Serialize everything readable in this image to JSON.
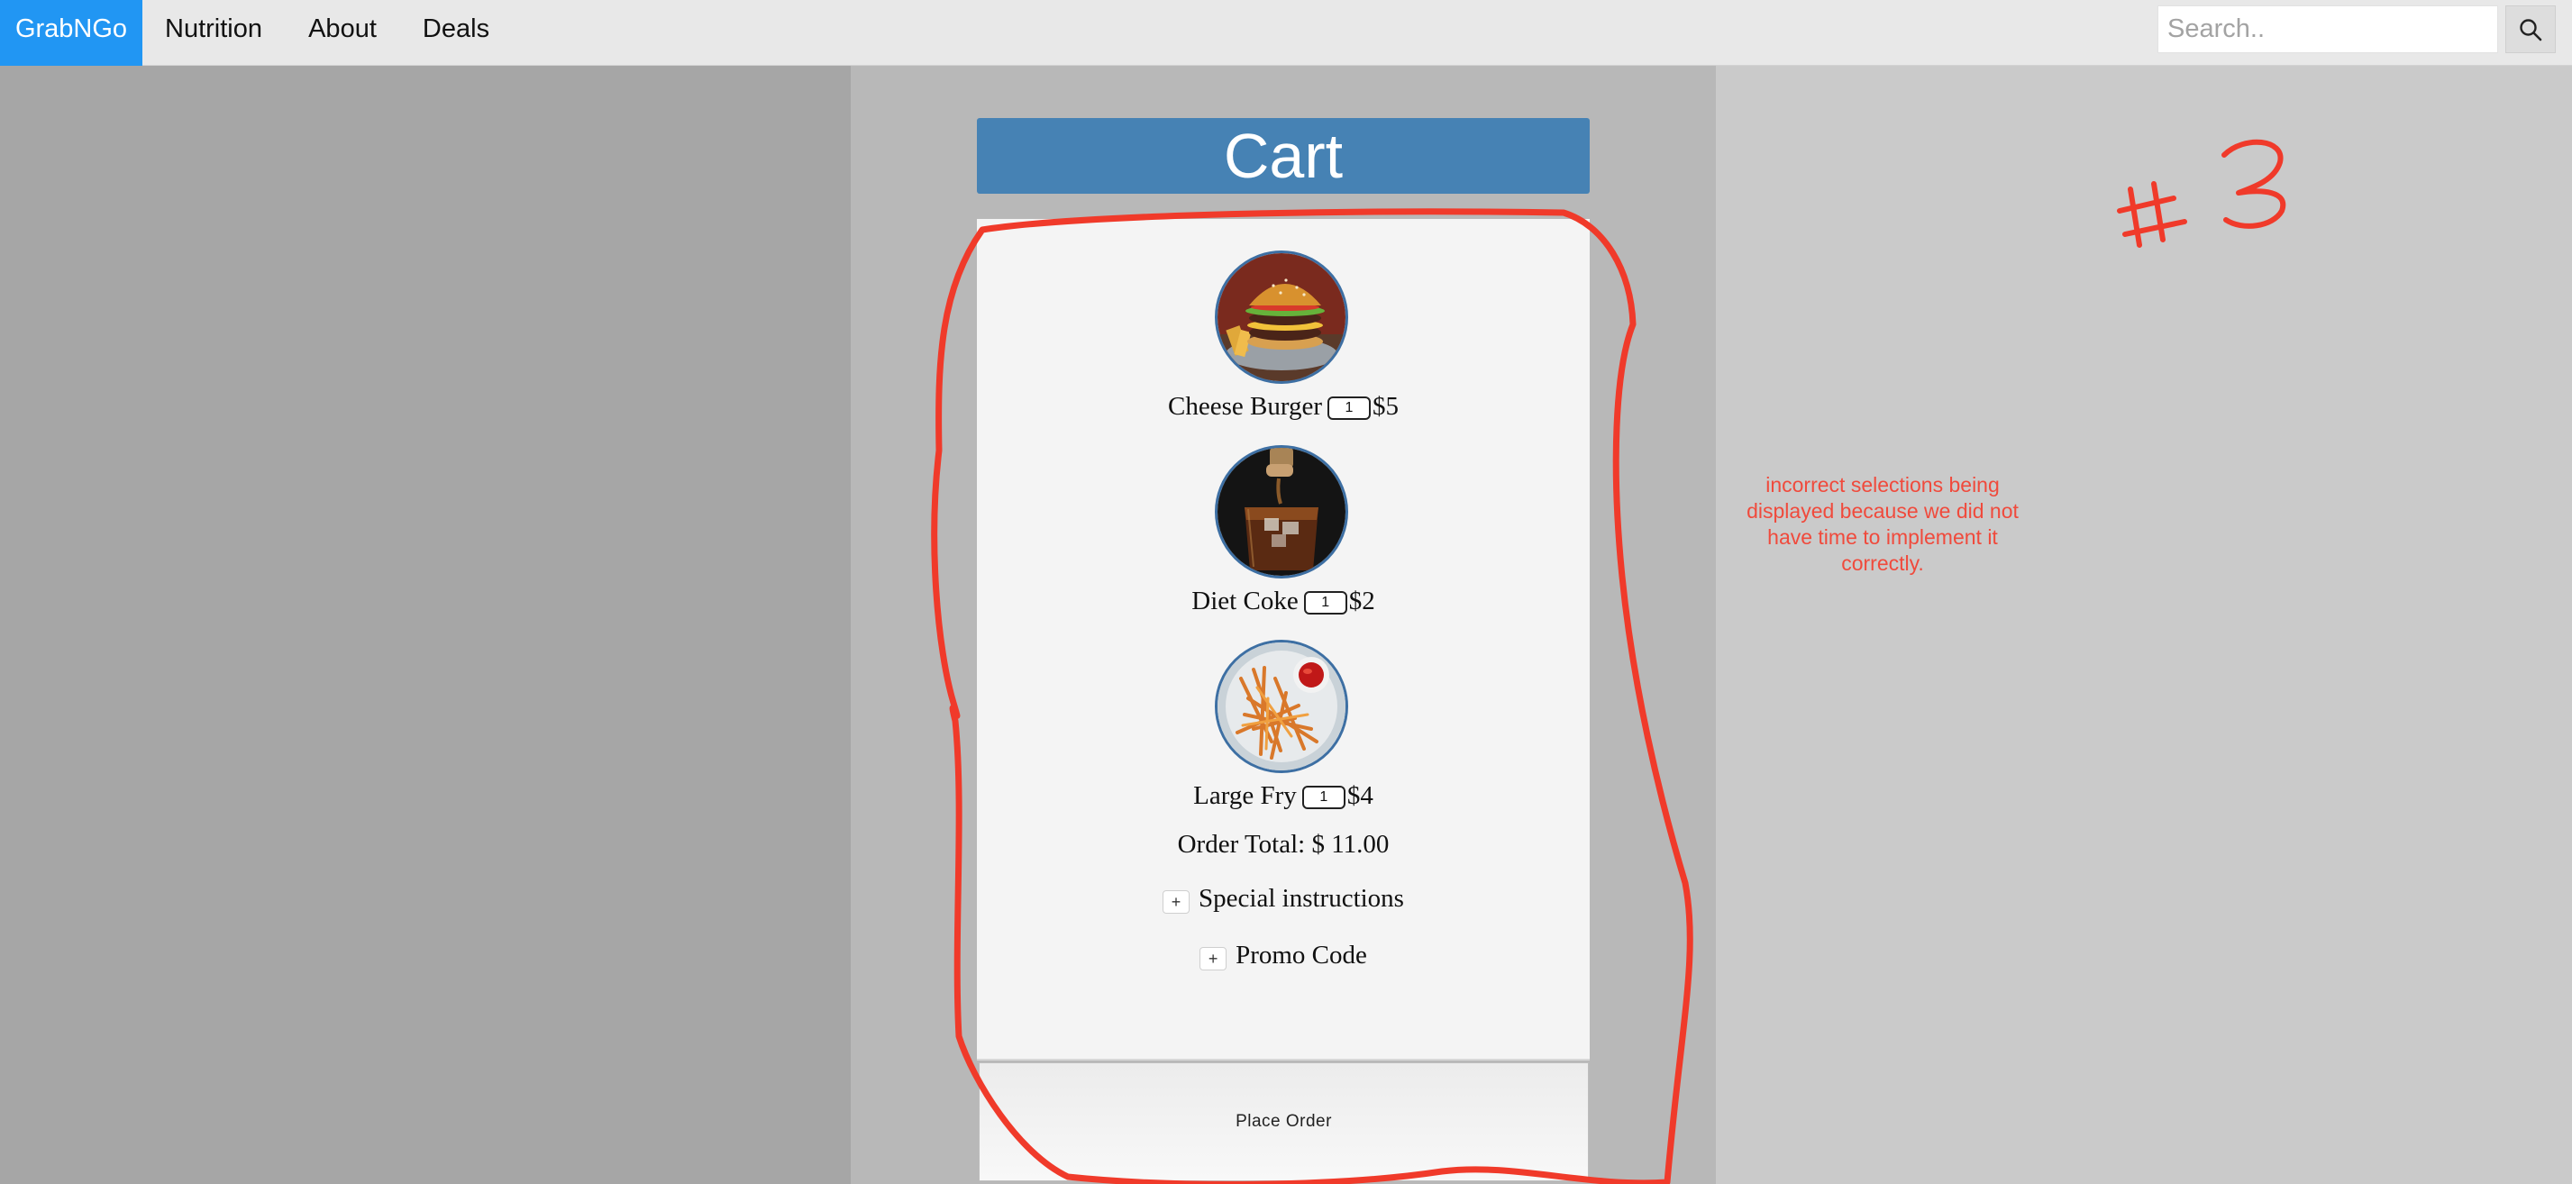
{
  "nav": {
    "brand": "GrabNGo",
    "links": [
      "Nutrition",
      "About",
      "Deals"
    ],
    "search_placeholder": "Search.."
  },
  "cart": {
    "title": "Cart",
    "items": [
      {
        "name": "Cheese Burger",
        "qty": "1",
        "price": "$5",
        "image": "cheeseburger"
      },
      {
        "name": "Diet Coke",
        "qty": "1",
        "price": "$2",
        "image": "cola-glass"
      },
      {
        "name": "Large Fry",
        "qty": "1",
        "price": "$4",
        "image": "french-fries"
      }
    ],
    "order_total": "Order Total: $ 11.00",
    "special_instructions": "Special instructions",
    "promo_code": "Promo Code",
    "expand_symbol": "+",
    "place_order": "Place Order"
  },
  "annotation": {
    "note": "incorrect selections being displayed because we did not have time to implement it correctly.",
    "label": "#3",
    "color": "#f03a2a"
  },
  "colors": {
    "brand": "#2196f3",
    "cart_header": "#4682b4",
    "annotation": "#f03a2a"
  }
}
